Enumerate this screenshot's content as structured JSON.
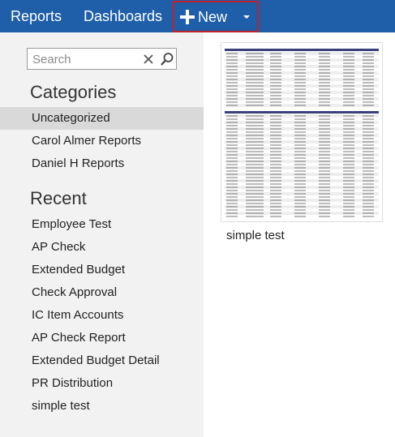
{
  "nav": {
    "reports": "Reports",
    "dashboards": "Dashboards",
    "new": "New"
  },
  "sidebar": {
    "search_placeholder": "Search",
    "categories_title": "Categories",
    "categories": [
      "Uncategorized",
      "Carol Almer Reports",
      "Daniel H Reports"
    ],
    "recent_title": "Recent",
    "recent": [
      "Employee Test",
      "AP Check",
      "Extended Budget",
      "Check Approval",
      "IC Item Accounts",
      "AP Check Report",
      "Extended Budget Detail",
      "PR Distribution",
      "simple test"
    ]
  },
  "main": {
    "report_title": "simple test"
  },
  "colors": {
    "header": "#1f5fa9",
    "highlight_border": "#c0222a",
    "sidebar_bg": "#f2f2f2",
    "selected_bg": "#d9d9d9"
  },
  "icons": {
    "new": "plus-icon",
    "dropdown": "chevron-down-icon",
    "clear": "close-icon",
    "search": "search-icon"
  }
}
